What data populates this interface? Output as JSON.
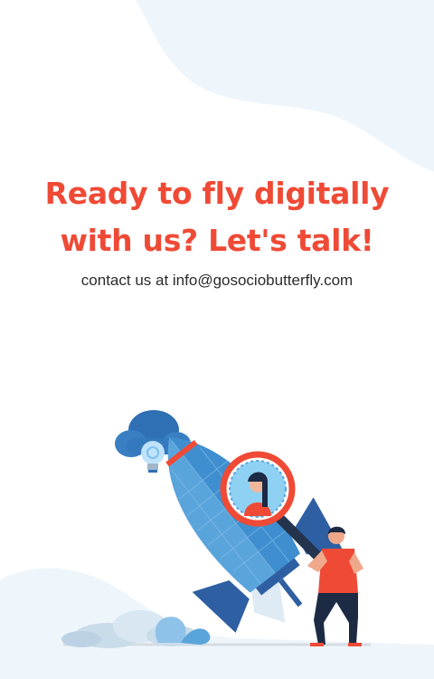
{
  "hero": {
    "headline_line1": "Ready to fly digitally",
    "headline_line2": "with us? Let's talk!",
    "contact_prefix": "contact us at ",
    "contact_email": "info@gosociobutterfly.com"
  },
  "colors": {
    "accent": "#ef4a36",
    "text": "#2b2b2b",
    "background_wash": "#eaf4fa",
    "rocket_blue": "#3f8fd0"
  },
  "illustration": {
    "icons": [
      "cloud-icon",
      "lightbulb-icon",
      "rocket-icon",
      "magnifying-glass-icon",
      "person-icon"
    ]
  }
}
